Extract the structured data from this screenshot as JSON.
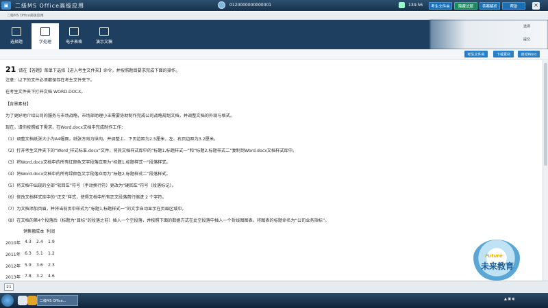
{
  "window": {
    "title": "二级MS Office高级应用",
    "candidate_id": "0120000000000001",
    "timer": "134:56",
    "buttons": {
      "btn1": "考生文件夹",
      "btn2": "隐藏试题",
      "btn3": "答案解析",
      "btn4": "帮助"
    }
  },
  "docbar": {
    "label": "二级MS Office高级应用"
  },
  "modules": [
    {
      "label": "选择题",
      "icon": "pencil-icon"
    },
    {
      "label": "字处理",
      "icon": "doc-icon"
    },
    {
      "label": "电子表格",
      "icon": "sheet-icon"
    },
    {
      "label": "演示文稿",
      "icon": "slides-icon"
    }
  ],
  "ribbon_right": {
    "r1": "选择",
    "r2": "提交"
  },
  "actions": {
    "a1": "考生文件夹",
    "a2": "下载素材",
    "a3": "启动Word"
  },
  "question": {
    "number": "21",
    "intro": "请在【答题】菜单下选择【进入考生文件夹】命令，并按照题目要求完成下面的操作。",
    "note": "注意：以下的文件必须都保存在考生文件夹下。",
    "open": "在考生文件夹下打开文档 WORD.DOCX。",
    "heading": "【背景素材】",
    "bg1": "为了更好地介绍公司的服务与市场战略，市场部助理小王需要协助制作完成公司战略规划文档，并调整文档的外观与格式。",
    "bg2": "现在，请你按照如下需求，在Word.docx文档中完成制作工作：",
    "steps": [
      "（1）调整文档纸张大小为A4幅面，纸张方向为纵向，并调整上、下页边距为2.5厘米，左、右页边距为3.2厘米。",
      "（2）打开考生文件夹下的“Word_样式标准.docx”文件，将其文档样式库中的“标题1,标题样式一”和“标题2,标题样式二”复制到Word.docx文档样式库中。",
      "（3）将Word.docx文档中的所有红颜色文字段落应用为“标题1,标题样式一”段落样式。",
      "（4）将Word.docx文档中的所有绿颜色文字段落应用为“标题2,标题样式二”段落样式。",
      "（5）将文档中出现的全部“软回车”符号（手动换行符）更改为“硬回车”符号（段落标记）。",
      "（6）修改文档样式库中的“正文”样式，使得文档中所有正文段落首行缩进 2 个字符。",
      "（7）为文档添加页眉，并将当前页中样式为“标题1,标题样式一”的文字自动显示在页眉区域中。",
      "（8）在文档的第4个段落后（标题为“目标”的段落之前）插入一个空段落，并按照下面的数据方式在此空段落中插入一个折线图图表，将图表的标题命名为“公司业务指标”。"
    ]
  },
  "table": {
    "headers": [
      "",
      "销售额",
      "成本",
      "利润"
    ],
    "rows": [
      [
        "2010年",
        "4.3",
        "2.4",
        "1.9"
      ],
      [
        "2011年",
        "6.3",
        "5.1",
        "1.2"
      ],
      [
        "2012年",
        "5.9",
        "3.6",
        "2.3"
      ],
      [
        "2013年",
        "7.8",
        "3.2",
        "4.6"
      ]
    ]
  },
  "watermark": {
    "en": "Future",
    "cn": "未来教育"
  },
  "bottom": {
    "page": "21"
  },
  "taskbar": {
    "task_label": "二级MS Office..."
  }
}
